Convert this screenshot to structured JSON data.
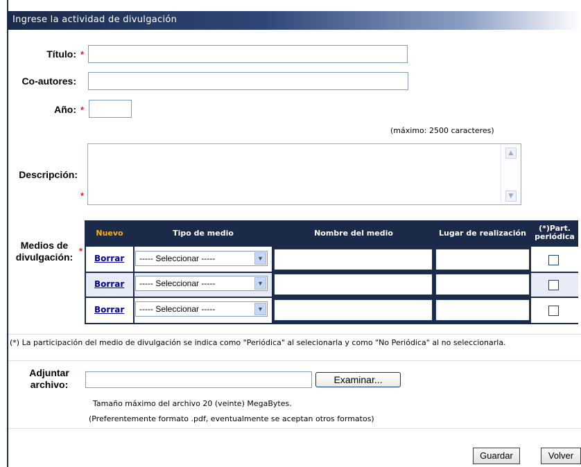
{
  "form": {
    "header": "Ingrese la actividad de divulgación",
    "required_mark": "*",
    "fields": {
      "titulo": {
        "label": "Título:",
        "value": ""
      },
      "coautores": {
        "label": "Co-autores:",
        "value": ""
      },
      "anio": {
        "label": "Año:",
        "value": ""
      },
      "descripcion": {
        "label": "Descripción:",
        "value": "",
        "note": "(máximo: 2500 caracteres)"
      }
    },
    "medios": {
      "label_line1": "Medios de",
      "label_line2": "divulgación:",
      "columns": {
        "nuevo": "Nuevo",
        "tipo": "Tipo de medio",
        "nombre": "Nombre del medio",
        "lugar": "Lugar de realización",
        "part_line1": "(*)Part.",
        "part_line2": "periódica"
      },
      "rows": [
        {
          "action": "Borrar",
          "tipo": "----- Seleccionar -----",
          "nombre": "",
          "lugar": "",
          "periodica": false
        },
        {
          "action": "Borrar",
          "tipo": "----- Seleccionar -----",
          "nombre": "",
          "lugar": "",
          "periodica": false
        },
        {
          "action": "Borrar",
          "tipo": "----- Seleccionar -----",
          "nombre": "",
          "lugar": "",
          "periodica": false
        }
      ],
      "footnote": "(*) La participación del medio de divulgación se indica como \"Periódica\" al selecionarla y como \"No Periódica\" al no seleccionarla."
    },
    "adjuntar": {
      "label_line1": "Adjuntar",
      "label_line2": "archivo:",
      "value": "",
      "browse_label": "Examinar...",
      "info_line1": "Tamaño máximo del archivo 20 (veinte) MegaBytes.",
      "info_line2": "(Preferentemente formato .pdf, eventualmente se aceptan otros formatos)"
    },
    "buttons": {
      "save": "Guardar",
      "back": "Volver"
    }
  },
  "colors": {
    "header_dark": "#1b2a48",
    "nuevo": "#ffb000",
    "link": "#000099",
    "required": "#e02020",
    "row_alt": "#e6ebf5"
  }
}
